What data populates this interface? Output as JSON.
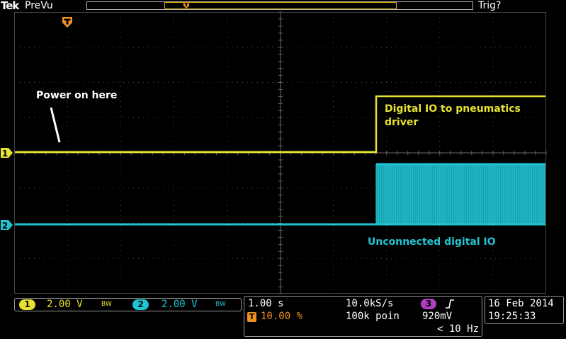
{
  "header": {
    "brand": "Tek",
    "mode": "PreVu",
    "trigger_status": "Trig?"
  },
  "markers": {
    "trigger_marker": "T",
    "ch1_marker": "1",
    "ch2_marker": "2"
  },
  "annotations": {
    "power_on": "Power on here",
    "digital_io_line1": "Digital IO to pneumatics",
    "digital_io_line2": "driver",
    "unconnected": "Unconnected digital IO"
  },
  "channels": [
    {
      "number": "1",
      "scale": "2.00 V",
      "bw_limit": "BW",
      "color": "#e6e230"
    },
    {
      "number": "2",
      "scale": "2.00 V",
      "bw_limit": "BW",
      "color": "#22c4d4"
    }
  ],
  "timebase": {
    "time_per_div": "1.00 s",
    "sample_rate": "10.0kS/s",
    "trigger_position_icon": "T",
    "trigger_position": "10.00 %",
    "record_length": "100k poin",
    "trigger_source": "3",
    "trigger_slope_icon": "rising-edge-icon",
    "trigger_level": "920mV",
    "trigger_frequency": "< 10 Hz"
  },
  "datetime": {
    "date": "16 Feb 2014",
    "time": "19:25:33"
  },
  "colors": {
    "ch1": "#e6e230",
    "ch2": "#22c4d4",
    "trigger": "#f09020",
    "ch3": "#b03cc0",
    "grid": "#4a4a4a"
  }
}
